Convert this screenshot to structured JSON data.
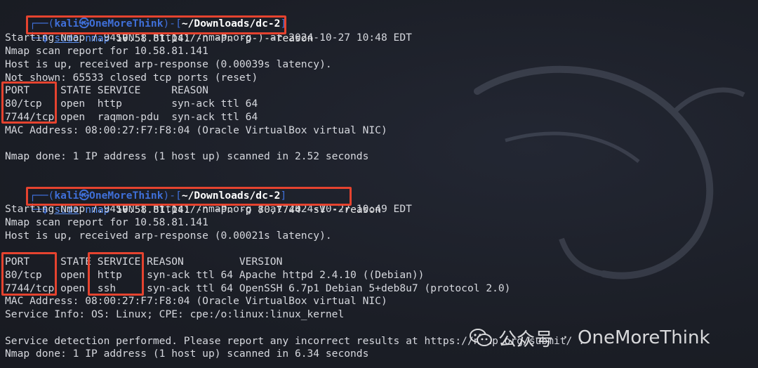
{
  "prompt1": {
    "deco_top": "┌──(",
    "user": "kali㉿OneMoreThink",
    "mid": ")-[",
    "path": "~/Downloads/dc-2",
    "end": "]",
    "deco_bottom": "└─",
    "dollar": "$",
    "sudo": "sudo",
    "nmap": "nmap",
    "args": " 10.58.81.141 -n -Pn -p- --reason"
  },
  "scan1": [
    "Starting Nmap 7.94SVN ( https://nmap.org ) at 2024-10-27 10:48 EDT",
    "Nmap scan report for 10.58.81.141",
    "Host is up, received arp-response (0.00039s latency).",
    "Not shown: 65533 closed tcp ports (reset)",
    "PORT     STATE SERVICE     REASON",
    "80/tcp   open  http        syn-ack ttl 64",
    "7744/tcp open  raqmon-pdu  syn-ack ttl 64",
    "MAC Address: 08:00:27:F7:F8:04 (Oracle VirtualBox virtual NIC)",
    "",
    "Nmap done: 1 IP address (1 host up) scanned in 2.52 seconds"
  ],
  "prompt2": {
    "deco_top": "┌──(",
    "user": "kali㉿OneMoreThink",
    "mid": ")-[",
    "path": "~/Downloads/dc-2",
    "end": "]",
    "deco_bottom": "└─",
    "dollar": "$",
    "sudo": "sudo",
    "nmap": "nmap",
    "args": " 10.58.81.141 -n -Pn -p 80,7744 -sV --reason"
  },
  "scan2": [
    "Starting Nmap 7.94SVN ( https://nmap.org ) at 2024-10-27 10:49 EDT",
    "Nmap scan report for 10.58.81.141",
    "Host is up, received arp-response (0.00021s latency).",
    "",
    "PORT     STATE SERVICE REASON         VERSION",
    "80/tcp   open  http    syn-ack ttl 64 Apache httpd 2.4.10 ((Debian))",
    "7744/tcp open  ssh     syn-ack ttl 64 OpenSSH 6.7p1 Debian 5+deb8u7 (protocol 2.0)",
    "MAC Address: 08:00:27:F7:F8:04 (Oracle VirtualBox virtual NIC)",
    "Service Info: OS: Linux; CPE: cpe:/o:linux:linux_kernel",
    "",
    "Service detection performed. Please report any incorrect results at https://nmap.org/submit/ .",
    "Nmap done: 1 IP address (1 host up) scanned in 6.34 seconds"
  ],
  "watermark": {
    "brand": "公众号",
    "separator": "·",
    "name": "OneMoreThink"
  },
  "colors": {
    "background": "#1b1e26",
    "highlight_box": "#e5432f",
    "prompt_blue": "#3f6fd8"
  }
}
